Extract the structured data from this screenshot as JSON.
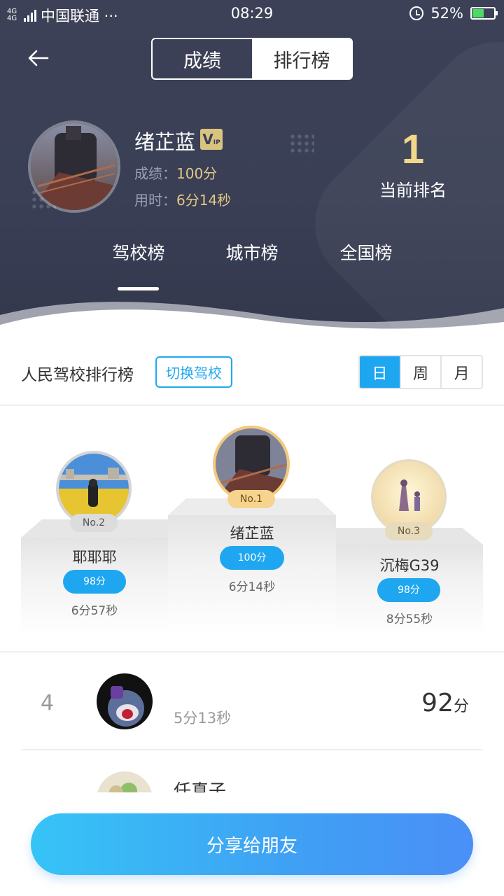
{
  "status_bar": {
    "network": "4G 4G",
    "carrier": "中国联通 ···",
    "time": "08:29",
    "battery": "52%"
  },
  "header": {
    "tabs": [
      "成绩",
      "排行榜"
    ],
    "active_tab": "排行榜",
    "user": {
      "name": "绪芷蓝",
      "vip": "V",
      "vip_sub": "IP",
      "score_label": "成绩：",
      "score": "100分",
      "time_label": "用时：",
      "time": "6分14秒"
    },
    "rank": {
      "value": "1",
      "label": "当前排名"
    },
    "board_tabs": [
      "驾校榜",
      "城市榜",
      "全国榜"
    ]
  },
  "board": {
    "title": "人民驾校排行榜",
    "switch_label": "切换驾校",
    "periods": [
      "日",
      "周",
      "月"
    ],
    "active_period": "日"
  },
  "podium": [
    {
      "rank": "No.1",
      "name": "绪芷蓝",
      "score": "100分",
      "time": "6分14秒"
    },
    {
      "rank": "No.2",
      "name": "耶耶耶",
      "score": "98分",
      "time": "6分57秒"
    },
    {
      "rank": "No.3",
      "name": "沉梅G39",
      "score": "98分",
      "time": "8分55秒"
    }
  ],
  "list": [
    {
      "rank": "4",
      "name": "",
      "time": "5分13秒",
      "score": "92",
      "unit": "分"
    },
    {
      "rank": "",
      "name": "任真子",
      "time": "",
      "score": "",
      "unit": ""
    }
  ],
  "share_label": "分享给朋友",
  "colors": {
    "accent": "#1ea7f0",
    "header_bg": "#3c4157",
    "gold": "#e3c886"
  }
}
